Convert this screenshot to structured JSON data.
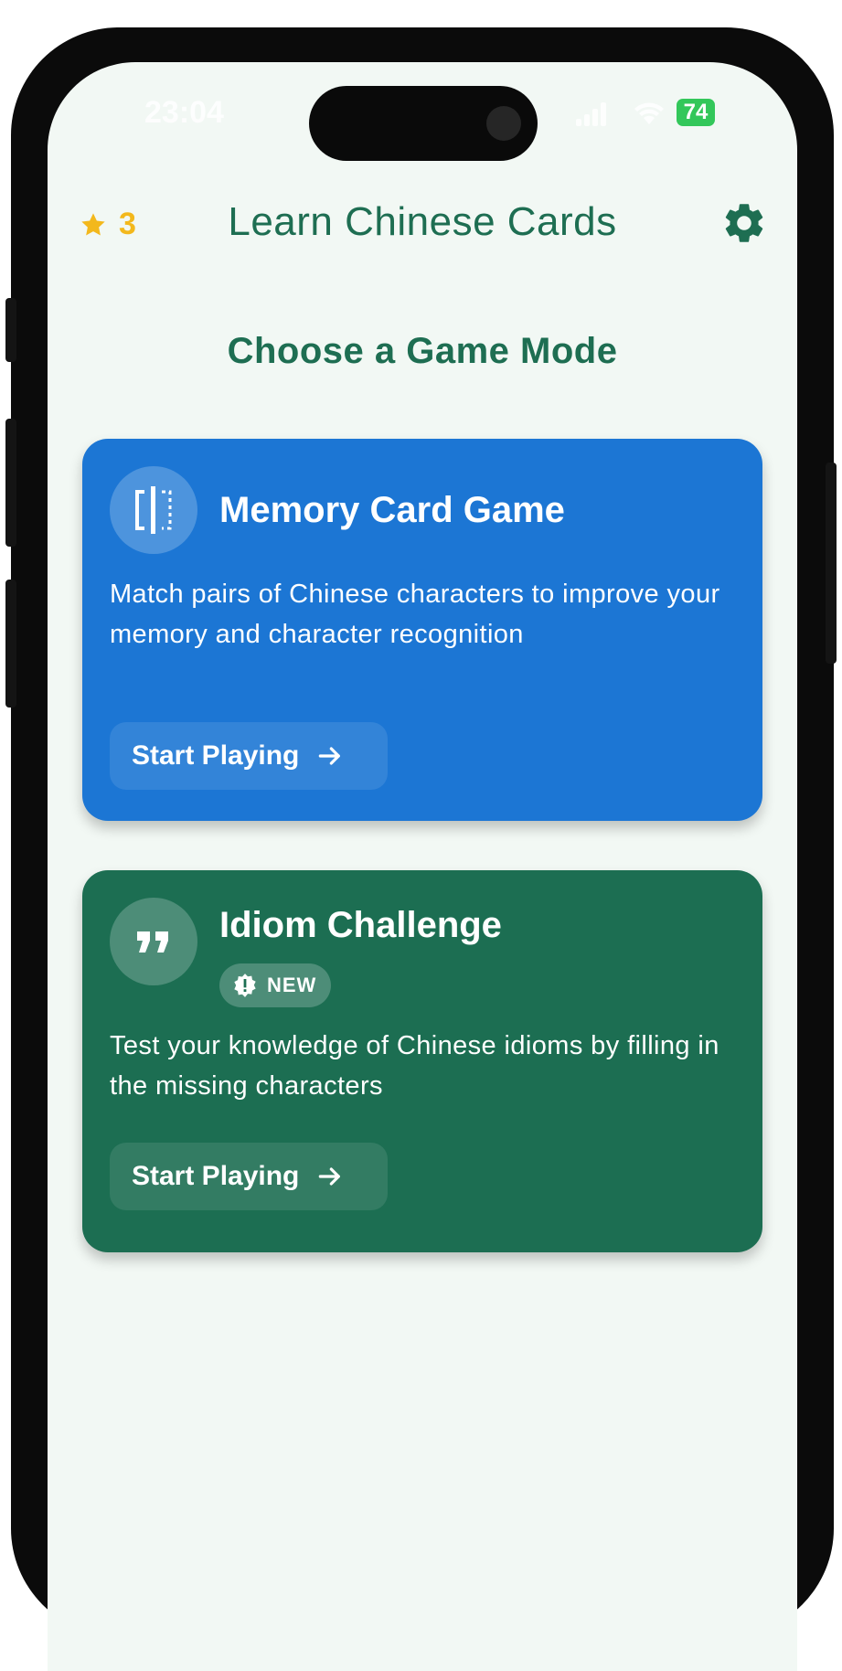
{
  "status_bar": {
    "time": "23:04",
    "battery": "74"
  },
  "header": {
    "star_count": "3",
    "title": "Learn Chinese Cards",
    "star_icon": "star-icon",
    "settings_icon": "gear-icon"
  },
  "main": {
    "section_title": "Choose a Game Mode",
    "cards": [
      {
        "title": "Memory Card Game",
        "description": "Match pairs of Chinese characters to improve your memory and character recognition",
        "button_label": "Start Playing",
        "icon": "flip-card-icon",
        "color": "#1c76d4"
      },
      {
        "title": "Idiom Challenge",
        "badge": "NEW",
        "description": "Test your knowledge of Chinese idioms by filling in the missing characters",
        "button_label": "Start Playing",
        "icon": "quote-icon",
        "color": "#1c6e52"
      }
    ]
  },
  "colors": {
    "primary_green": "#1e6e52",
    "star_gold": "#f3b81c",
    "background": "#f2f8f4",
    "battery_green": "#33c75a"
  }
}
